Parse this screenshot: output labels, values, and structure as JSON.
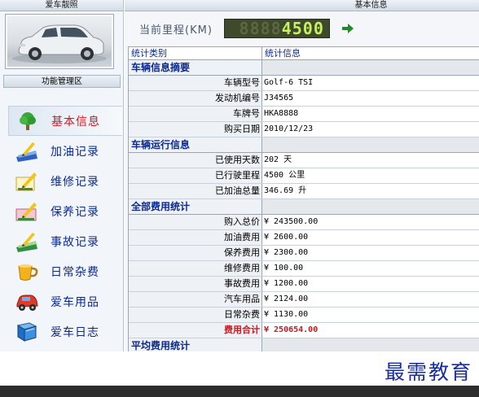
{
  "sidebar": {
    "photo_title": "爱车靓照",
    "menu_title": "功能管理区",
    "items": [
      {
        "label": "基本信息",
        "icon": "tree-icon",
        "active": true
      },
      {
        "label": "加油记录",
        "icon": "pen-note-icon"
      },
      {
        "label": "维修记录",
        "icon": "pencil-note-icon"
      },
      {
        "label": "保养记录",
        "icon": "pencil-note-icon"
      },
      {
        "label": "事故记录",
        "icon": "pen-note-icon"
      },
      {
        "label": "日常杂费",
        "icon": "cup-icon"
      },
      {
        "label": "爱车用品",
        "icon": "toy-car-icon"
      },
      {
        "label": "爱车日志",
        "icon": "book-icon"
      }
    ]
  },
  "main": {
    "title": "基本信息",
    "odometer_label": "当前里程(KM)",
    "odometer_ghost": "8888",
    "odometer_value": "4500",
    "grid": {
      "col1": "统计类别",
      "col2": "统计信息"
    },
    "sections": [
      {
        "title": "车辆信息摘要",
        "rows": [
          {
            "label": "车辆型号",
            "value": "Golf-6 TSI"
          },
          {
            "label": "发动机编号",
            "value": "J34565"
          },
          {
            "label": "车牌号",
            "value": "HKA8888"
          },
          {
            "label": "购买日期",
            "value": "2010/12/23"
          }
        ]
      },
      {
        "title": "车辆运行信息",
        "rows": [
          {
            "label": "已使用天数",
            "value": "202 天"
          },
          {
            "label": "已行驶里程",
            "value": "4500 公里"
          },
          {
            "label": "已加油总量",
            "value": "346.69 升"
          }
        ]
      },
      {
        "title": "全部费用统计",
        "rows": [
          {
            "label": "购入总价",
            "value": "¥ 243500.00"
          },
          {
            "label": "加油费用",
            "value": "¥ 2600.00"
          },
          {
            "label": "保养费用",
            "value": "¥ 2300.00"
          },
          {
            "label": "维修费用",
            "value": "¥ 100.00"
          },
          {
            "label": "事故费用",
            "value": "¥ 1200.00"
          },
          {
            "label": "汽车用品",
            "value": "¥ 2124.00"
          },
          {
            "label": "日常杂费",
            "value": "¥ 1130.00"
          },
          {
            "label": "费用合计",
            "value": "¥ 250654.00",
            "total": true
          }
        ]
      },
      {
        "title": "平均费用统计",
        "rows": []
      }
    ]
  },
  "watermark": "最需教育",
  "colors": {
    "accent_blue": "#0b2a8f",
    "active_red": "#d4141a",
    "lcd_bg": "#3f4a2c",
    "lcd_fg": "#c8f05a"
  }
}
